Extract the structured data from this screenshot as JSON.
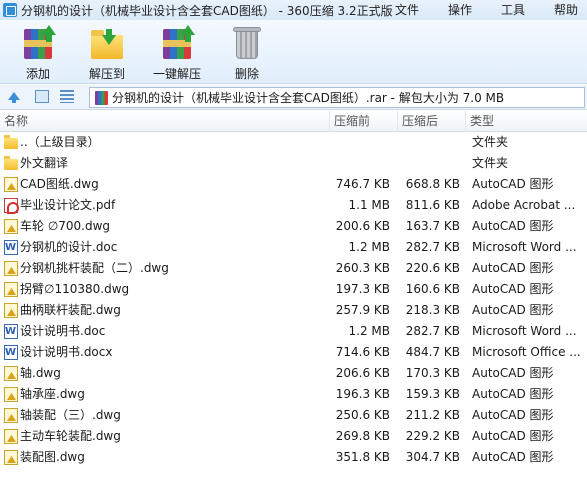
{
  "window": {
    "title": "分钢机的设计（机械毕业设计含全套CAD图纸） - 360压缩 3.2正式版",
    "menu": [
      "文件",
      "操作",
      "工具",
      "帮助"
    ]
  },
  "toolbar": {
    "add_label": "添加",
    "extract_label": "解压到",
    "oneclick_label": "一键解压",
    "delete_label": "删除"
  },
  "address": {
    "path": "分钢机的设计（机械毕业设计含全套CAD图纸）.rar - 解包大小为 7.0 MB"
  },
  "columns": {
    "name": "名称",
    "size": "压缩前",
    "packed": "压缩后",
    "type": "类型"
  },
  "files": [
    {
      "name": "..（上级目录）",
      "size": "",
      "packed": "",
      "type": "文件夹",
      "icon": "folder-icon"
    },
    {
      "name": "外文翻译",
      "size": "",
      "packed": "",
      "type": "文件夹",
      "icon": "folder-icon"
    },
    {
      "name": "CAD图纸.dwg",
      "size": "746.7 KB",
      "packed": "668.8 KB",
      "type": "AutoCAD 图形",
      "icon": "autocad-file-icon"
    },
    {
      "name": "毕业设计论文.pdf",
      "size": "1.1 MB",
      "packed": "811.6 KB",
      "type": "Adobe Acrobat ...",
      "icon": "pdf-file-icon"
    },
    {
      "name": "车轮 ∅700.dwg",
      "size": "200.6 KB",
      "packed": "163.7 KB",
      "type": "AutoCAD 图形",
      "icon": "autocad-file-icon"
    },
    {
      "name": "分钢机的设计.doc",
      "size": "1.2 MB",
      "packed": "282.7 KB",
      "type": "Microsoft Word ...",
      "icon": "word-file-icon"
    },
    {
      "name": "分钢机挑杆装配（二）.dwg",
      "size": "260.3 KB",
      "packed": "220.6 KB",
      "type": "AutoCAD 图形",
      "icon": "autocad-file-icon"
    },
    {
      "name": "拐臂∅110380.dwg",
      "size": "197.3 KB",
      "packed": "160.6 KB",
      "type": "AutoCAD 图形",
      "icon": "autocad-file-icon"
    },
    {
      "name": "曲柄联杆装配.dwg",
      "size": "257.9 KB",
      "packed": "218.3 KB",
      "type": "AutoCAD 图形",
      "icon": "autocad-file-icon"
    },
    {
      "name": "设计说明书.doc",
      "size": "1.2 MB",
      "packed": "282.7 KB",
      "type": "Microsoft Word ...",
      "icon": "word-file-icon"
    },
    {
      "name": "设计说明书.docx",
      "size": "714.6 KB",
      "packed": "484.7 KB",
      "type": "Microsoft Office ...",
      "icon": "word-file-icon"
    },
    {
      "name": "轴.dwg",
      "size": "206.6 KB",
      "packed": "170.3 KB",
      "type": "AutoCAD 图形",
      "icon": "autocad-file-icon"
    },
    {
      "name": "轴承座.dwg",
      "size": "196.3 KB",
      "packed": "159.3 KB",
      "type": "AutoCAD 图形",
      "icon": "autocad-file-icon"
    },
    {
      "name": "轴装配（三）.dwg",
      "size": "250.6 KB",
      "packed": "211.2 KB",
      "type": "AutoCAD 图形",
      "icon": "autocad-file-icon"
    },
    {
      "name": "主动车轮装配.dwg",
      "size": "269.8 KB",
      "packed": "229.2 KB",
      "type": "AutoCAD 图形",
      "icon": "autocad-file-icon"
    },
    {
      "name": "装配图.dwg",
      "size": "351.8 KB",
      "packed": "304.7 KB",
      "type": "AutoCAD 图形",
      "icon": "autocad-file-icon"
    }
  ]
}
